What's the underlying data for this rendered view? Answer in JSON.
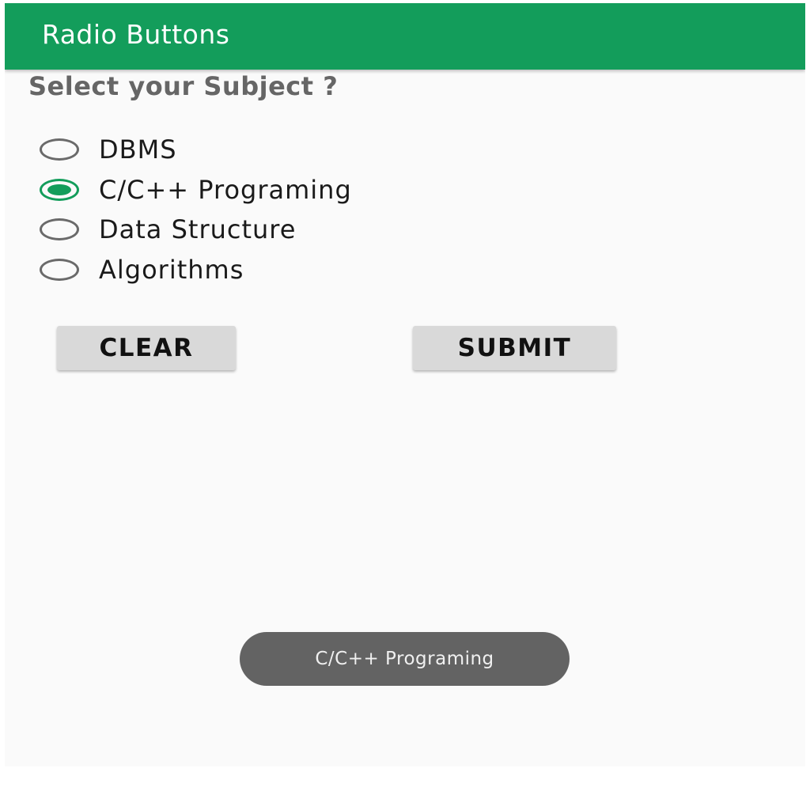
{
  "app": {
    "title": "Radio Buttons",
    "accent_color": "#139d5b"
  },
  "main": {
    "prompt": "Select your Subject ?",
    "options": [
      {
        "label": "DBMS",
        "checked": false
      },
      {
        "label": "C/C++ Programing",
        "checked": true
      },
      {
        "label": "Data Structure",
        "checked": false
      },
      {
        "label": "Algorithms",
        "checked": false
      }
    ],
    "clear_label": "CLEAR",
    "submit_label": "SUBMIT"
  },
  "toast": {
    "text": "C/C++ Programing"
  }
}
